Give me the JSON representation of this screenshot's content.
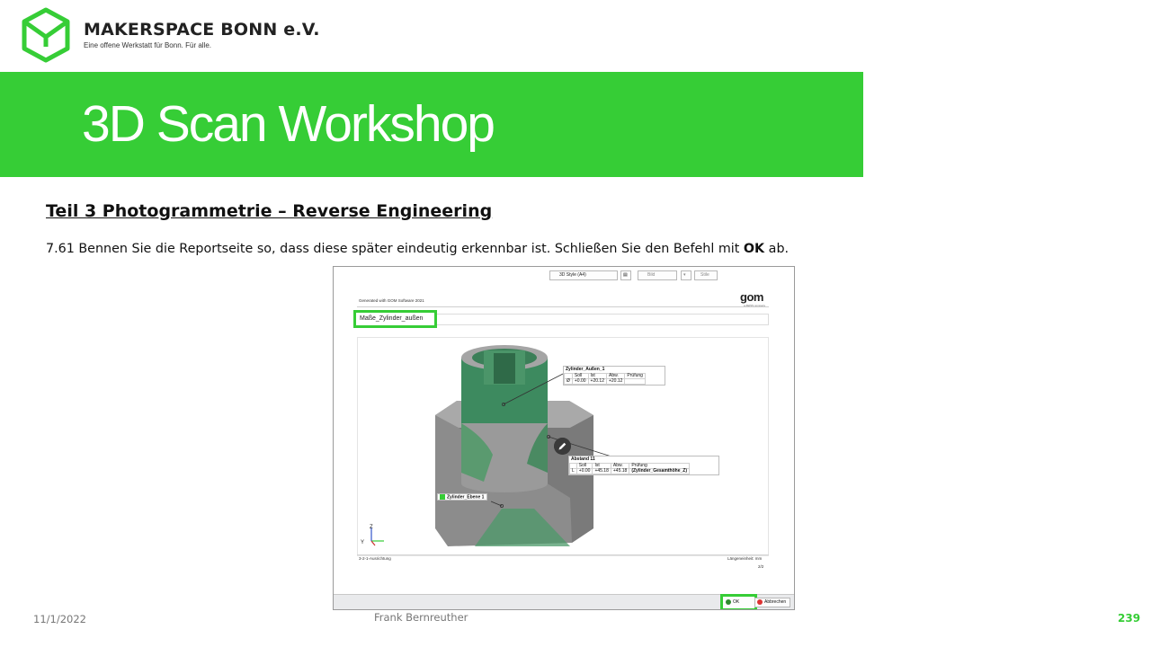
{
  "brand": {
    "name": "MAKERSPACE BONN e.V.",
    "tagline": "Eine offene Werkstatt für Bonn. Für alle.",
    "logo_icon": "makerspace-cube-logo",
    "accent_color": "#36cd36"
  },
  "banner": {
    "title": "3D Scan Workshop"
  },
  "section": {
    "heading": "Teil 3  Photogrammetrie  – Reverse Engineering",
    "instruction_prefix": "7.61 Bennen Sie die Reportseite so, dass diese später eindeutig erkennbar ist. Schließen Sie den Befehl mit ",
    "instruction_bold": "OK",
    "instruction_suffix": " ab."
  },
  "screenshot": {
    "generated_label": "Generated with GOM Software 2021",
    "gom_logo": "gom",
    "gom_sub": "a ZEISS company",
    "title_input_value": "Maße_Zylinder_außen",
    "alignment_label": "3-2-1-Ausrichtung",
    "unit_label": "Längeneinheit: mm",
    "page_indicator": "2/2",
    "callout_zylinder": {
      "title": "Zylinder_Außen_1",
      "headers": [
        "",
        "Soll",
        "Ist",
        "Abw.",
        "Prüfung"
      ],
      "row": [
        "Ø",
        "+0.00",
        "+20.12",
        "+20.12",
        ""
      ]
    },
    "callout_abstand": {
      "title": "Abstand 11",
      "headers": [
        "",
        "Soll",
        "Ist",
        "Abw.",
        "Prüfung"
      ],
      "row": [
        "L",
        "+0.00",
        "+45.18",
        "+45.18",
        "(Zylinder_Gesamthöhe_Z)"
      ]
    },
    "callout_ebene": {
      "title": "Zylinder_Ebene 1"
    },
    "axis_labels": {
      "y": "Y",
      "z": "Z"
    },
    "toolbar": {
      "style_select": "3D Style (A4)",
      "bild_label": "Bild",
      "stile_label": "Stile",
      "ok_label": "OK",
      "cancel_label": "Abbrechen"
    }
  },
  "footer": {
    "date": "11/1/2022",
    "author": "Frank Bernreuther",
    "page_number": "239"
  }
}
